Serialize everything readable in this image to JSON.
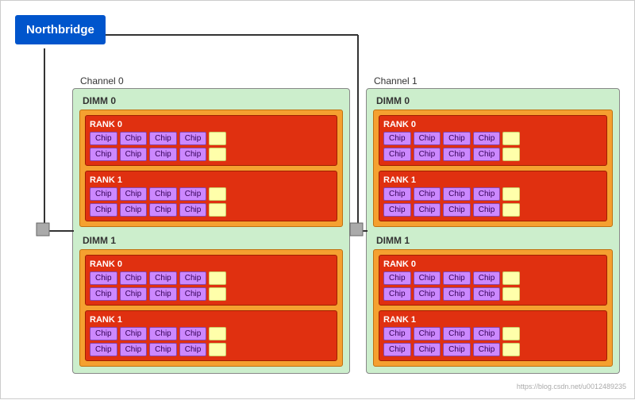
{
  "northbridge": {
    "label": "Northbridge"
  },
  "channels": [
    {
      "id": "channel-0",
      "label": "Channel 0",
      "dimms": [
        {
          "id": "dimm-0-0",
          "label": "DIMM 0",
          "ranks": [
            {
              "id": "rank-0-0-0",
              "label": "RANK 0",
              "rows": [
                [
                  "Chip",
                  "Chip",
                  "Chip",
                  "Chip"
                ],
                [
                  "Chip",
                  "Chip",
                  "Chip",
                  "Chip"
                ]
              ]
            },
            {
              "id": "rank-0-0-1",
              "label": "RANK 1",
              "rows": [
                [
                  "Chip",
                  "Chip",
                  "Chip",
                  "Chip"
                ],
                [
                  "Chip",
                  "Chip",
                  "Chip",
                  "Chip"
                ]
              ]
            }
          ]
        },
        {
          "id": "dimm-0-1",
          "label": "DIMM 1",
          "ranks": [
            {
              "id": "rank-0-1-0",
              "label": "RANK 0",
              "rows": [
                [
                  "Chip",
                  "Chip",
                  "Chip",
                  "Chip"
                ],
                [
                  "Chip",
                  "Chip",
                  "Chip",
                  "Chip"
                ]
              ]
            },
            {
              "id": "rank-0-1-1",
              "label": "RANK 1",
              "rows": [
                [
                  "Chip",
                  "Chip",
                  "Chip",
                  "Chip"
                ],
                [
                  "Chip",
                  "Chip",
                  "Chip",
                  "Chip"
                ]
              ]
            }
          ]
        }
      ]
    },
    {
      "id": "channel-1",
      "label": "Channel 1",
      "dimms": [
        {
          "id": "dimm-1-0",
          "label": "DIMM 0",
          "ranks": [
            {
              "id": "rank-1-0-0",
              "label": "RANK 0",
              "rows": [
                [
                  "Chip",
                  "Chip",
                  "Chip",
                  "Chip"
                ],
                [
                  "Chip",
                  "Chip",
                  "Chip",
                  "Chip"
                ]
              ]
            },
            {
              "id": "rank-1-0-1",
              "label": "RANK 1",
              "rows": [
                [
                  "Chip",
                  "Chip",
                  "Chip",
                  "Chip"
                ],
                [
                  "Chip",
                  "Chip",
                  "Chip",
                  "Chip"
                ]
              ]
            }
          ]
        },
        {
          "id": "dimm-1-1",
          "label": "DIMM 1",
          "ranks": [
            {
              "id": "rank-1-1-0",
              "label": "RANK 0",
              "rows": [
                [
                  "Chip",
                  "Chip",
                  "Chip",
                  "Chip"
                ],
                [
                  "Chip",
                  "Chip",
                  "Chip",
                  "Chip"
                ]
              ]
            },
            {
              "id": "rank-1-1-1",
              "label": "RANK 1",
              "rows": [
                [
                  "Chip",
                  "Chip",
                  "Chip",
                  "Chip"
                ],
                [
                  "Chip",
                  "Chip",
                  "Chip",
                  "Chip"
                ]
              ]
            }
          ]
        }
      ]
    }
  ],
  "watermark": "https://blog.csdn.net/u0012489235",
  "colors": {
    "northbridge_bg": "#0055cc",
    "channel_bg": "#cceecc",
    "dimm_bg": "#f5a030",
    "rank_bg": "#e03010",
    "chip_bg": "#cc88ff",
    "chip_spacer_bg": "#ffffaa"
  }
}
